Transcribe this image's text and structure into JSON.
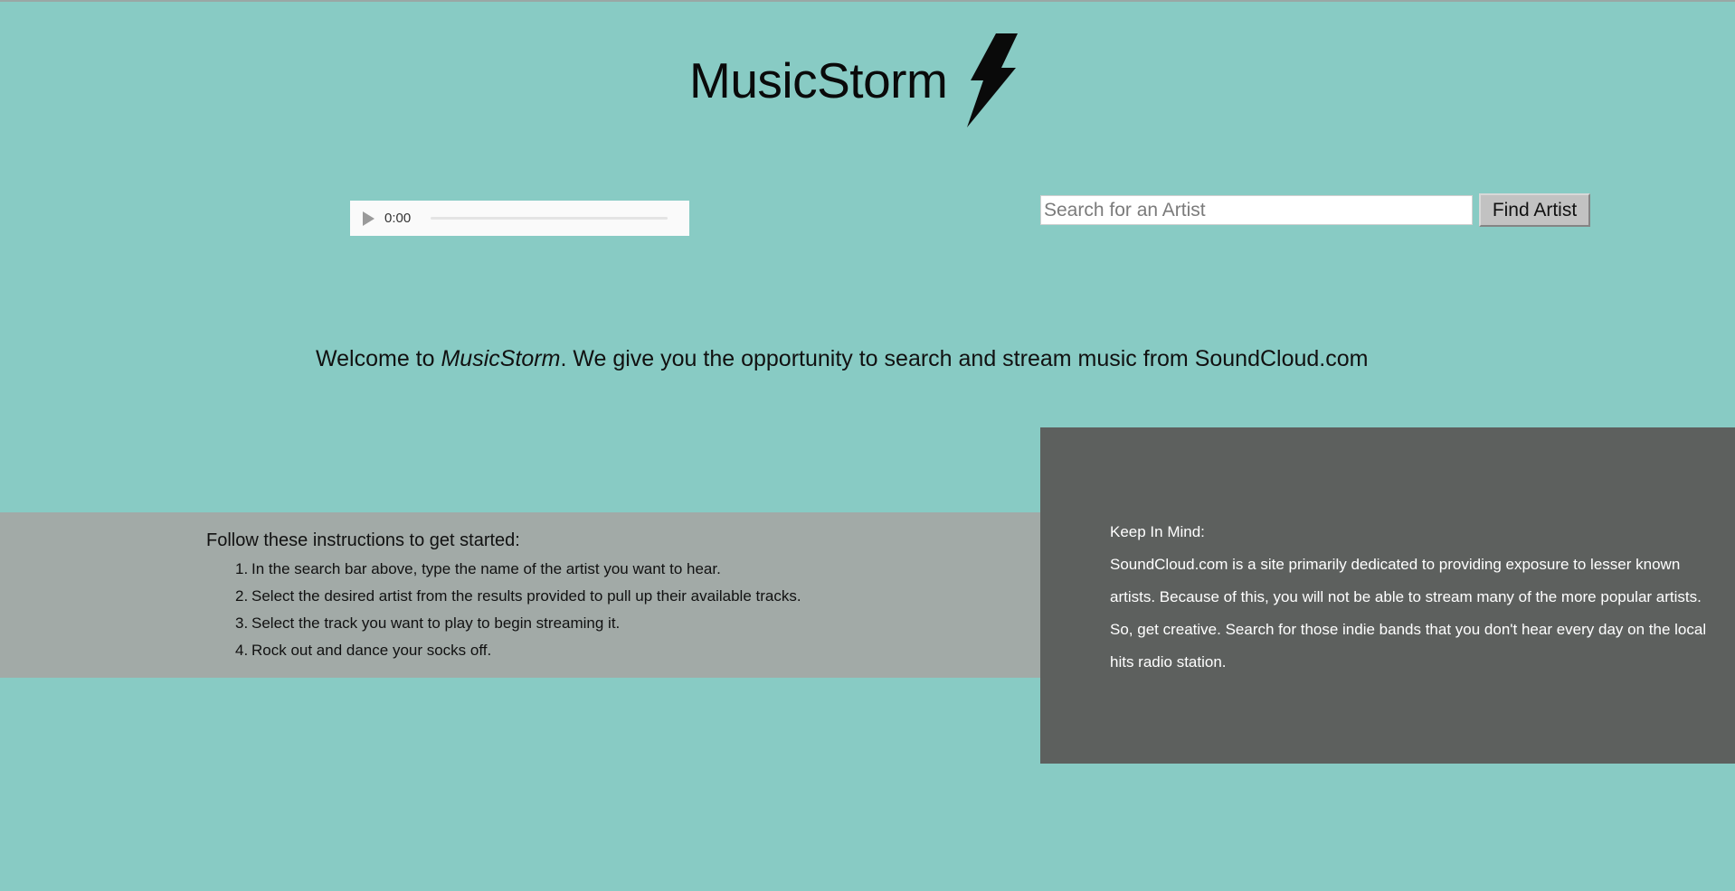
{
  "header": {
    "title": "MusicStorm",
    "logo_icon": "lightning-bolt-icon"
  },
  "player": {
    "time": "0:00",
    "progress": 0
  },
  "search": {
    "placeholder": "Search for an Artist",
    "value": "",
    "button_label": "Find Artist"
  },
  "welcome": {
    "prefix": "Welcome to ",
    "brand": "MusicStorm",
    "suffix": ". We give you the opportunity to search and stream music from SoundCloud.com"
  },
  "instructions": {
    "heading": "Follow these instructions to get started:",
    "items": [
      {
        "num": "1.",
        "text": "In the search bar above, type the name of the artist you want to hear."
      },
      {
        "num": "2.",
        "text": "Select the desired artist from the results provided to pull up their available tracks."
      },
      {
        "num": "3.",
        "text": "Select the track you want to play to begin streaming it."
      },
      {
        "num": "4.",
        "text": "Rock out and dance your socks off."
      }
    ]
  },
  "keep_in_mind": {
    "heading": "Keep In Mind:",
    "body": "SoundCloud.com is a site primarily dedicated to providing exposure to lesser known artists. Because of this, you will not be able to stream many of the more popular artists. So, get creative. Search for those indie bands that you don't hear every day on the local hits radio station."
  },
  "colors": {
    "background": "#88cbc4",
    "instructions_band": "#a2aaa7",
    "keep_box": "#5d605e"
  }
}
